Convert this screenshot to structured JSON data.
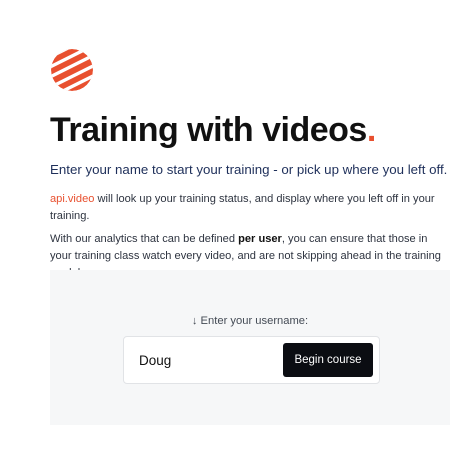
{
  "header": {
    "title": "Training with videos",
    "title_dot": ".",
    "subtitle": "Enter your name to start your training - or pick up where you left off."
  },
  "intro": {
    "brand_name": "api.video",
    "text1": " will look up your training status, and display where you left off in your training.",
    "text2_a": "With our analytics that can be defined ",
    "text2_strong": "per user",
    "text2_b": ", you can ensure that those in your training class watch every video, and are not skipping ahead in the training module."
  },
  "form": {
    "prompt": "↓ Enter your username:",
    "username_value": "Doug",
    "button_label": "Begin course"
  },
  "colors": {
    "brand_accent": "#e8502f",
    "button_bg": "#0b0d12",
    "panel_bg": "#f6f7f8",
    "subtitle_text": "#1e2f5a"
  },
  "icons": {
    "logo": "api-video-striped-circle-icon"
  }
}
